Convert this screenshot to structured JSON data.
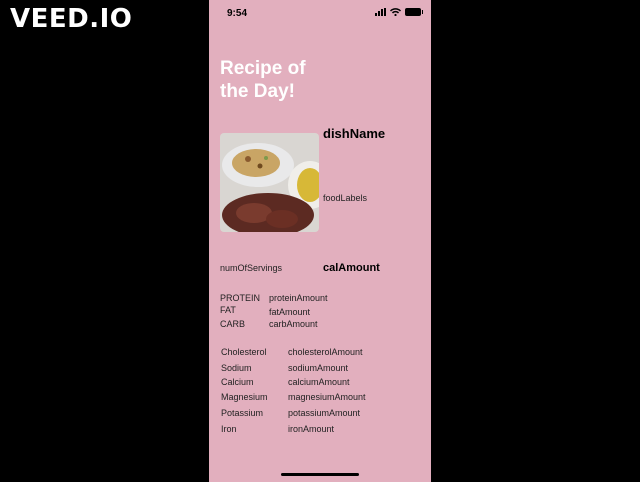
{
  "watermark": "VEED.IO",
  "status_bar": {
    "time": "9:54",
    "icons": [
      "signal-icon",
      "wifi-icon",
      "battery-icon"
    ]
  },
  "screen": {
    "title": "Recipe of the Day!",
    "dish_name": "dishName",
    "food_labels": "foodLabels",
    "num_servings": "numOfServings",
    "cal_amount": "calAmount",
    "macros": [
      {
        "label": "PROTEIN",
        "value": "proteinAmount"
      },
      {
        "label": "FAT",
        "value": "fatAmount"
      },
      {
        "label": "CARB",
        "value": "carbAmount"
      }
    ],
    "minerals": [
      {
        "label": "Cholesterol",
        "value": "cholesterolAmount"
      },
      {
        "label": "Sodium",
        "value": "sodiumAmount"
      },
      {
        "label": "Calcium",
        "value": "calciumAmount"
      },
      {
        "label": "Magnesium",
        "value": "magnesiumAmount"
      },
      {
        "label": "Potassium",
        "value": "potassiumAmount"
      },
      {
        "label": "Iron",
        "value": "ironAmount"
      }
    ]
  },
  "colors": {
    "background": "#e2afbe",
    "outer": "#000000",
    "title": "#ffffff"
  }
}
